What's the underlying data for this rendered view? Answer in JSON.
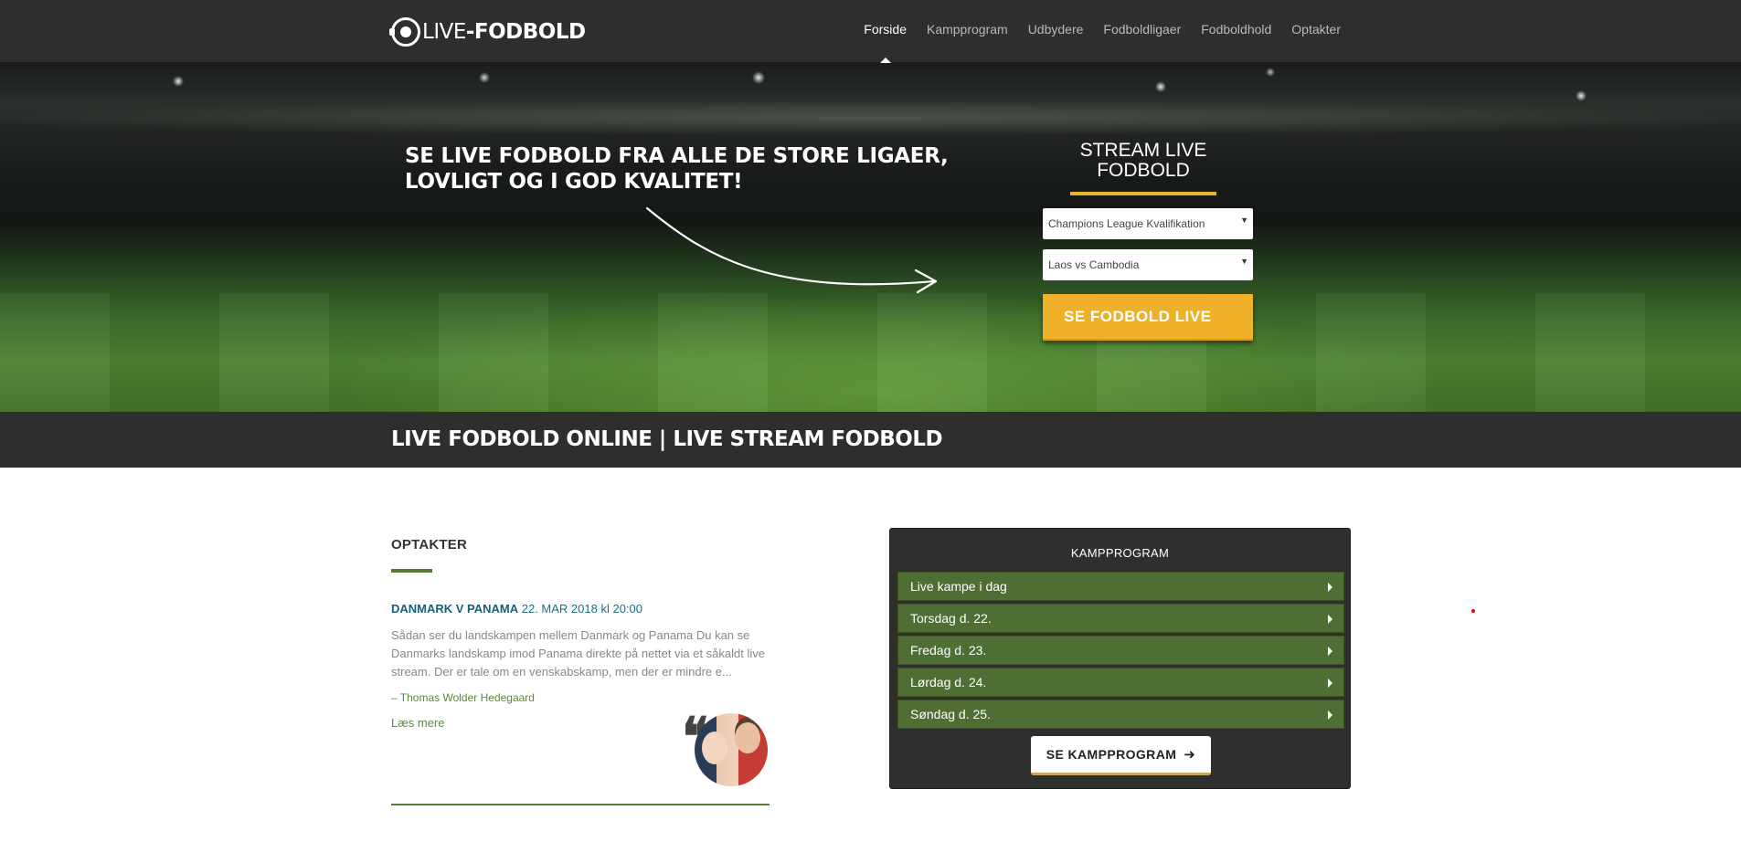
{
  "header": {
    "logo_thin": "LIVE",
    "logo_bold": "-FODBOLD",
    "nav": [
      "Forside",
      "Kampprogram",
      "Udbydere",
      "Fodboldligaer",
      "Fodboldhold",
      "Optakter"
    ]
  },
  "hero": {
    "headline": "SE LIVE FODBOLD FRA ALLE DE STORE LIGAER, LOVLIGT OG I GOD KVALITET!",
    "stream_title": "STREAM LIVE FODBOLD",
    "league_select": "Champions League Kvalifikation",
    "match_select": "Laos vs Cambodia",
    "cta_label": "SE FODBOLD LIVE"
  },
  "titleband": {
    "title": "LIVE FODBOLD ONLINE | LIVE STREAM FODBOLD"
  },
  "optakter": {
    "title": "OPTAKTER",
    "match": "DANMARK V PANAMA",
    "datetime": " 22. MAR 2018 kl 20:00",
    "body": "Sådan ser du landskampen mellem Danmark og Panama Du kan se Danmarks landskamp imod Panama direkte på nettet via et såkaldt live stream. Der er tale om en venskabskamp, men der er mindre e...",
    "author": "– Thomas Wolder Hedegaard",
    "readmore": "Læs mere",
    "quote_glyph": "❝"
  },
  "kampprogram": {
    "title": "KAMPPROGRAM",
    "rows": [
      "Live kampe i dag",
      "Torsdag d. 22.",
      "Fredag d. 23.",
      "Lørdag d. 24.",
      "Søndag d. 25."
    ],
    "button_label": "SE KAMPPROGRAM",
    "button_icon": "➜"
  },
  "colors": {
    "accent_orange": "#f0b12a",
    "green": "#4e6e33",
    "dark": "#2e2e2d"
  }
}
